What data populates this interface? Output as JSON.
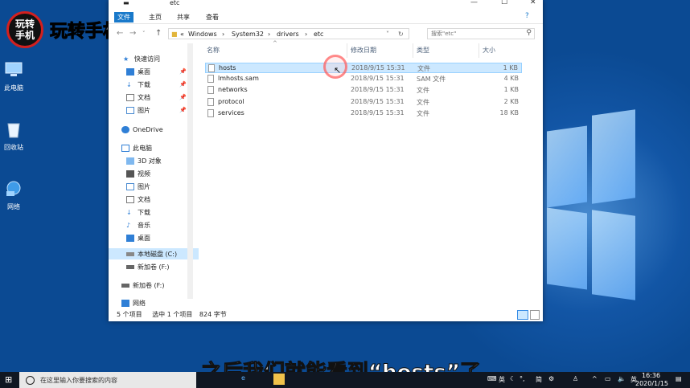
{
  "brand": {
    "badge_line1": "玩转",
    "badge_line2": "手机",
    "name": "玩转手机"
  },
  "desktop_icons": [
    {
      "label": "此电脑"
    },
    {
      "label": "回收站"
    },
    {
      "label": "网络"
    }
  ],
  "window": {
    "title": "etc",
    "controls": {
      "minimize": "—",
      "maximize": "☐",
      "close": "✕"
    },
    "ribbon_tabs": [
      "文件",
      "主页",
      "共享",
      "查看"
    ],
    "address": {
      "prefix": "«",
      "segments": [
        "Windows",
        "System32",
        "drivers",
        "etc"
      ],
      "search_placeholder": "搜索\"etc\""
    },
    "sidebar": [
      {
        "label": "快速访问"
      },
      {
        "label": "桌面"
      },
      {
        "label": "下载"
      },
      {
        "label": "文档"
      },
      {
        "label": "图片"
      },
      {
        "label": "OneDrive"
      },
      {
        "label": "此电脑"
      },
      {
        "label": "3D 对象"
      },
      {
        "label": "视频"
      },
      {
        "label": "图片"
      },
      {
        "label": "文档"
      },
      {
        "label": "下载"
      },
      {
        "label": "音乐"
      },
      {
        "label": "桌面"
      },
      {
        "label": "本地磁盘 (C:)"
      },
      {
        "label": "新加卷 (F:)"
      },
      {
        "label": "新加卷 (F:)"
      },
      {
        "label": "网络"
      }
    ],
    "columns": [
      "名称",
      "修改日期",
      "类型",
      "大小"
    ],
    "files": [
      {
        "name": "hosts",
        "date": "2018/9/15 15:31",
        "type": "文件",
        "size": "1 KB"
      },
      {
        "name": "lmhosts.sam",
        "date": "2018/9/15 15:31",
        "type": "SAM 文件",
        "size": "4 KB"
      },
      {
        "name": "networks",
        "date": "2018/9/15 15:31",
        "type": "文件",
        "size": "1 KB"
      },
      {
        "name": "protocol",
        "date": "2018/9/15 15:31",
        "type": "文件",
        "size": "2 KB"
      },
      {
        "name": "services",
        "date": "2018/9/15 15:31",
        "type": "文件",
        "size": "18 KB"
      }
    ],
    "status": {
      "count": "5 个项目",
      "selected": "选中 1 个项目",
      "size": "824 字节"
    }
  },
  "caption": "之后我们就能看到“hosts”了",
  "taskbar": {
    "search_placeholder": "在这里输入你要搜索的内容",
    "ime": "英",
    "ime2": "简",
    "time": "16:36",
    "date": "2020/1/15"
  }
}
